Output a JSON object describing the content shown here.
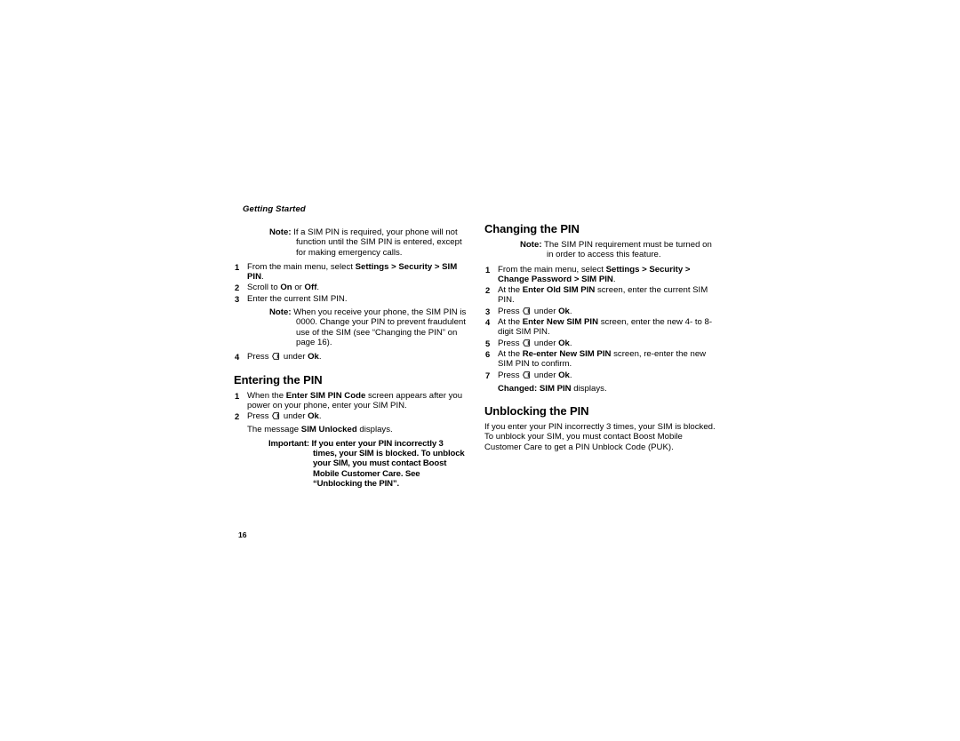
{
  "page": {
    "running_head": "Getting Started",
    "folio": "16"
  },
  "icons": {
    "softkey": "softkey-left-icon"
  },
  "left_column": {
    "blocks": [
      {
        "kind": "callout",
        "name": "note-sim-pin-required",
        "label": "Note:",
        "runs": [
          {
            "t": "If a SIM PIN is required, your phone will not function until the SIM PIN is entered, except for making emergency calls.",
            "b": false
          }
        ]
      },
      {
        "kind": "step",
        "name": "step-left-1",
        "num": "1",
        "runs": [
          {
            "t": "From the main menu, select ",
            "b": false
          },
          {
            "t": "Settings > Security > SIM PIN",
            "b": true
          },
          {
            "t": ".",
            "b": false
          }
        ]
      },
      {
        "kind": "step",
        "name": "step-left-2",
        "num": "2",
        "runs": [
          {
            "t": "Scroll to ",
            "b": false
          },
          {
            "t": "On",
            "b": true
          },
          {
            "t": " or ",
            "b": false
          },
          {
            "t": "Off",
            "b": true
          },
          {
            "t": ".",
            "b": false
          }
        ]
      },
      {
        "kind": "step",
        "name": "step-left-3",
        "num": "3",
        "runs": [
          {
            "t": "Enter the current SIM PIN.",
            "b": false
          }
        ]
      },
      {
        "kind": "callout",
        "name": "note-default-pin",
        "label": "Note:",
        "runs": [
          {
            "t": "When you receive your phone, the SIM PIN is 0000. Change your PIN to prevent fraudulent use of the SIM (see “Changing the PIN” on page 16).",
            "b": false
          }
        ]
      },
      {
        "kind": "step",
        "name": "step-left-4",
        "num": "4",
        "runs": [
          {
            "t": "Press ",
            "b": false
          },
          {
            "icon": "softkey"
          },
          {
            "t": " under ",
            "b": false
          },
          {
            "t": "Ok",
            "b": true
          },
          {
            "t": ".",
            "b": false
          }
        ]
      },
      {
        "kind": "heading",
        "name": "heading-entering-the-pin",
        "text": "Entering the PIN"
      },
      {
        "kind": "step",
        "name": "step-entering-1",
        "num": "1",
        "runs": [
          {
            "t": "When the ",
            "b": false
          },
          {
            "t": "Enter SIM PIN Code",
            "b": true
          },
          {
            "t": " screen appears after you power on your phone, enter your SIM PIN.",
            "b": false
          }
        ]
      },
      {
        "kind": "step",
        "name": "step-entering-2",
        "num": "2",
        "runs": [
          {
            "t": "Press ",
            "b": false
          },
          {
            "icon": "softkey"
          },
          {
            "t": " under ",
            "b": false
          },
          {
            "t": "Ok",
            "b": true
          },
          {
            "t": ".",
            "b": false
          }
        ]
      },
      {
        "kind": "follow",
        "name": "result-sim-unlocked",
        "runs": [
          {
            "t": "The message ",
            "b": false
          },
          {
            "t": "SIM Unlocked",
            "b": true
          },
          {
            "t": " displays.",
            "b": false
          }
        ]
      },
      {
        "kind": "callout",
        "name": "important-pin-blocked",
        "variant": "important",
        "label": "Important:",
        "runs": [
          {
            "t": "If you enter your PIN incorrectly 3 times, your SIM is blocked. To unblock your SIM, you must contact Boost Mobile Customer Care. See “Unblocking the PIN”.",
            "b": true
          }
        ]
      }
    ]
  },
  "right_column": {
    "blocks": [
      {
        "kind": "heading",
        "name": "heading-changing-the-pin",
        "text": "Changing the PIN"
      },
      {
        "kind": "callout",
        "name": "note-requirement-turned-on",
        "label": "Note:",
        "runs": [
          {
            "t": "The SIM PIN requirement must be turned on in order to access this feature.",
            "b": false
          }
        ]
      },
      {
        "kind": "step",
        "name": "step-changing-1",
        "num": "1",
        "runs": [
          {
            "t": "From the main menu, select ",
            "b": false
          },
          {
            "t": "Settings > Security > Change Password > SIM PIN",
            "b": true
          },
          {
            "t": ".",
            "b": false
          }
        ]
      },
      {
        "kind": "step",
        "name": "step-changing-2",
        "num": "2",
        "runs": [
          {
            "t": "At the ",
            "b": false
          },
          {
            "t": "Enter Old SIM PIN",
            "b": true
          },
          {
            "t": " screen, enter the current SIM PIN.",
            "b": false
          }
        ]
      },
      {
        "kind": "step",
        "name": "step-changing-3",
        "num": "3",
        "runs": [
          {
            "t": "Press ",
            "b": false
          },
          {
            "icon": "softkey"
          },
          {
            "t": " under ",
            "b": false
          },
          {
            "t": "Ok",
            "b": true
          },
          {
            "t": ".",
            "b": false
          }
        ]
      },
      {
        "kind": "step",
        "name": "step-changing-4",
        "num": "4",
        "runs": [
          {
            "t": "At the ",
            "b": false
          },
          {
            "t": "Enter New SIM PIN",
            "b": true
          },
          {
            "t": " screen, enter the new 4- to 8-digit SIM PIN.",
            "b": false
          }
        ]
      },
      {
        "kind": "step",
        "name": "step-changing-5",
        "num": "5",
        "runs": [
          {
            "t": "Press ",
            "b": false
          },
          {
            "icon": "softkey"
          },
          {
            "t": " under ",
            "b": false
          },
          {
            "t": "Ok",
            "b": true
          },
          {
            "t": ".",
            "b": false
          }
        ]
      },
      {
        "kind": "step",
        "name": "step-changing-6",
        "num": "6",
        "runs": [
          {
            "t": "At the ",
            "b": false
          },
          {
            "t": "Re-enter New SIM PIN",
            "b": true
          },
          {
            "t": " screen, re-enter the new SIM PIN to confirm.",
            "b": false
          }
        ]
      },
      {
        "kind": "step",
        "name": "step-changing-7",
        "num": "7",
        "runs": [
          {
            "t": "Press ",
            "b": false
          },
          {
            "icon": "softkey"
          },
          {
            "t": " under ",
            "b": false
          },
          {
            "t": "Ok",
            "b": true
          },
          {
            "t": ".",
            "b": false
          }
        ]
      },
      {
        "kind": "follow",
        "name": "result-changed-sim-pin",
        "runs": [
          {
            "t": "Changed: SIM PIN",
            "b": true
          },
          {
            "t": " displays.",
            "b": false
          }
        ]
      },
      {
        "kind": "heading",
        "name": "heading-unblocking-the-pin",
        "text": "Unblocking the PIN"
      },
      {
        "kind": "para",
        "name": "para-unblocking-body",
        "runs": [
          {
            "t": "If you enter your PIN incorrectly 3 times, your SIM is blocked. To unblock your SIM, you must contact Boost Mobile Customer Care to get a PIN Unblock Code (PUK).",
            "b": false
          }
        ]
      }
    ]
  }
}
